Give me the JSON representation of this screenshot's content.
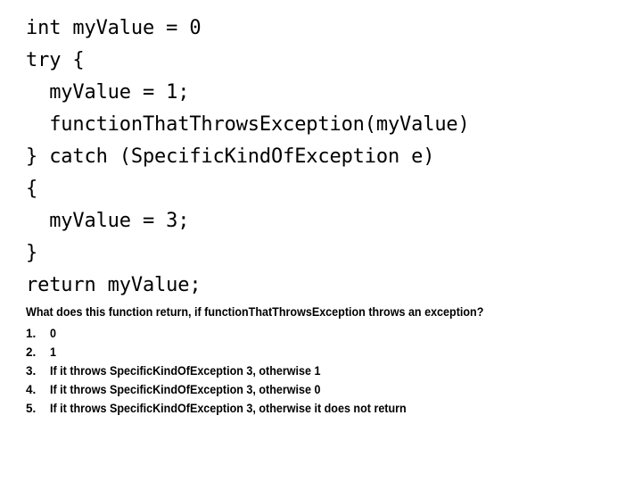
{
  "slide": {
    "background_color": "#ffffff",
    "text_color": "#000000"
  },
  "code": {
    "language": "java-like-pseudocode",
    "lines": [
      "int myValue = 0",
      "try {",
      "  myValue = 1;",
      "  functionThatThrowsException(myValue)",
      "} catch (SpecificKindOfException e)",
      "{",
      "  myValue = 3;",
      "}",
      "return myValue;"
    ]
  },
  "question": {
    "prompt": "What does this function return, if functionThatThrowsException throws an exception?",
    "answers": [
      {
        "number": "1.",
        "label": "0"
      },
      {
        "number": "2.",
        "label": "1"
      },
      {
        "number": "3.",
        "label": "If it throws SpecificKindOfException 3, otherwise 1"
      },
      {
        "number": "4.",
        "label": "If it throws SpecificKindOfException 3, otherwise 0"
      },
      {
        "number": "5.",
        "label": "If it throws SpecificKindOfException 3, otherwise it does not return"
      }
    ]
  }
}
